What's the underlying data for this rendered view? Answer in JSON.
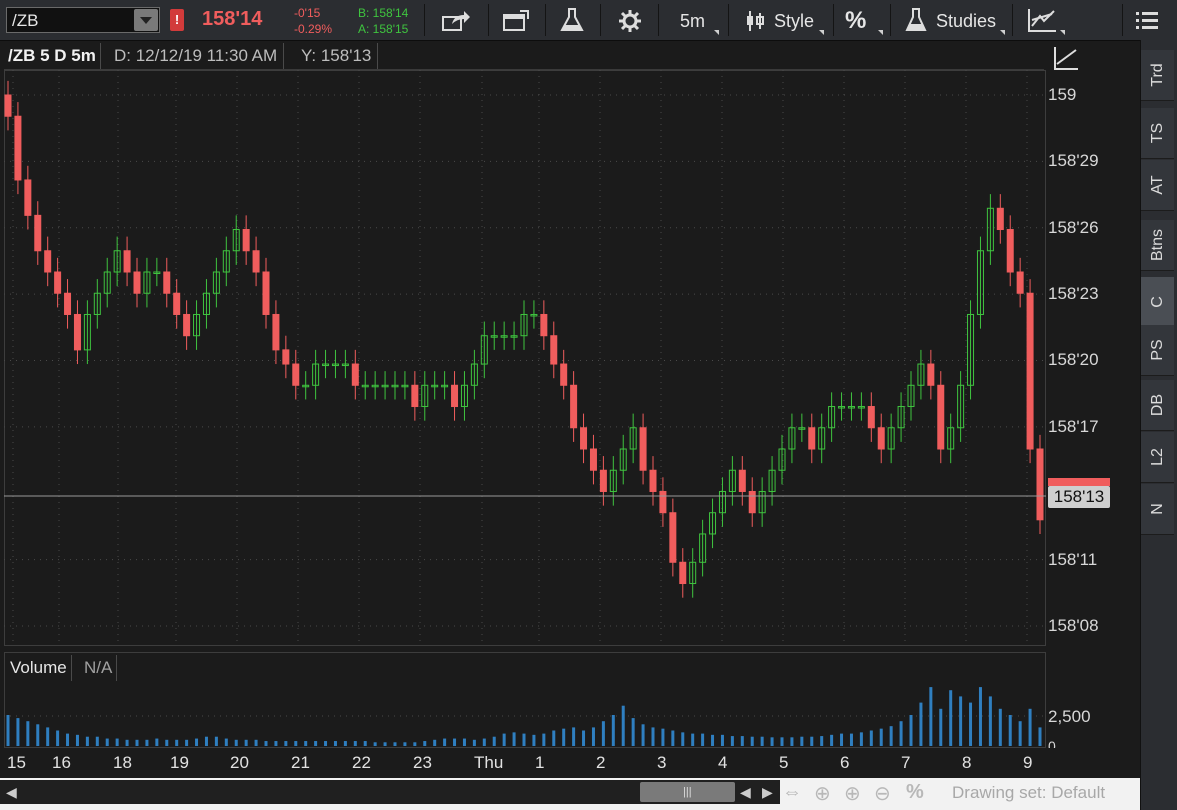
{
  "toolbar": {
    "symbol": "/ZB",
    "last_price": "158'14",
    "change_abs": "-0'15",
    "change_pct": "-0.29%",
    "bid": "B: 158'14",
    "ask": "A: 158'15",
    "timeframe_label": "5m",
    "style_label": "Style",
    "percent_label": "%",
    "studies_label": "Studies"
  },
  "chart_header": {
    "symbol_period": "/ZB 5 D 5m",
    "date_readout": "D: 12/12/19 11:30 AM",
    "y_readout": "Y: 158'13"
  },
  "price_axis": {
    "ticks": [
      "159",
      "158'29",
      "158'26",
      "158'23",
      "158'20",
      "158'17",
      "158'11",
      "158'08"
    ],
    "current_tag": "158'13"
  },
  "volume_panel": {
    "label": "Volume",
    "value": "N/A",
    "axis_tick": "2,500",
    "axis_zero": "0"
  },
  "time_axis": {
    "labels": [
      "15",
      "16",
      "18",
      "19",
      "20",
      "21",
      "22",
      "23",
      "Thu",
      "1",
      "2",
      "3",
      "4",
      "5",
      "6",
      "7",
      "8",
      "9"
    ]
  },
  "sidebar": {
    "tabs": [
      "Trd",
      "TS",
      "AT",
      "Btns",
      "C",
      "PS",
      "DB",
      "L2",
      "N"
    ],
    "active": "C"
  },
  "bottom_bar": {
    "drawing_set": "Drawing set: Default",
    "percent_label": "%"
  },
  "colors": {
    "up": "#3fc43f",
    "down": "#f05d5d",
    "volume": "#2f7fc0",
    "background": "#1b1b1b",
    "grid": "#4a4a4a"
  },
  "chart_data": {
    "type": "bar",
    "symbol": "/ZB",
    "aggregation": "5m",
    "span": "5 D",
    "title": "/ZB 5 D 5m",
    "ylim_ticks": [
      159.0,
      158.90625,
      158.8125,
      158.71875,
      158.625,
      158.53125,
      158.34375,
      158.25
    ],
    "y_format": "32nds",
    "closes": [
      158.97,
      158.88,
      158.83,
      158.78,
      158.75,
      158.72,
      158.69,
      158.64,
      158.69,
      158.72,
      158.75,
      158.78,
      158.75,
      158.72,
      158.75,
      158.75,
      158.72,
      158.69,
      158.66,
      158.69,
      158.72,
      158.75,
      158.78,
      158.81,
      158.78,
      158.75,
      158.69,
      158.64,
      158.62,
      158.59,
      158.59,
      158.62,
      158.62,
      158.62,
      158.62,
      158.59,
      158.59,
      158.59,
      158.59,
      158.59,
      158.59,
      158.56,
      158.59,
      158.59,
      158.59,
      158.56,
      158.59,
      158.62,
      158.66,
      158.66,
      158.66,
      158.66,
      158.69,
      158.69,
      158.66,
      158.62,
      158.59,
      158.53,
      158.5,
      158.47,
      158.44,
      158.47,
      158.5,
      158.53,
      158.47,
      158.44,
      158.41,
      158.34,
      158.31,
      158.34,
      158.38,
      158.41,
      158.44,
      158.47,
      158.44,
      158.41,
      158.44,
      158.47,
      158.5,
      158.53,
      158.53,
      158.5,
      158.53,
      158.56,
      158.56,
      158.56,
      158.56,
      158.53,
      158.5,
      158.53,
      158.56,
      158.59,
      158.62,
      158.59,
      158.5,
      158.53,
      158.59,
      158.69,
      158.78,
      158.84,
      158.81,
      158.75,
      158.72,
      158.5,
      158.4
    ],
    "volume_axis": {
      "tick": 2500
    },
    "volume_profile": [
      0.5,
      0.45,
      0.4,
      0.35,
      0.3,
      0.25,
      0.2,
      0.18,
      0.15,
      0.15,
      0.12,
      0.12,
      0.1,
      0.1,
      0.1,
      0.12,
      0.1,
      0.1,
      0.1,
      0.12,
      0.15,
      0.15,
      0.12,
      0.1,
      0.1,
      0.1,
      0.08,
      0.08,
      0.08,
      0.08,
      0.08,
      0.08,
      0.08,
      0.08,
      0.08,
      0.08,
      0.08,
      0.06,
      0.06,
      0.06,
      0.06,
      0.06,
      0.08,
      0.1,
      0.12,
      0.12,
      0.12,
      0.1,
      0.12,
      0.15,
      0.2,
      0.22,
      0.2,
      0.18,
      0.2,
      0.25,
      0.28,
      0.3,
      0.25,
      0.3,
      0.4,
      0.5,
      0.65,
      0.45,
      0.35,
      0.3,
      0.28,
      0.25,
      0.22,
      0.2,
      0.2,
      0.18,
      0.18,
      0.16,
      0.16,
      0.15,
      0.15,
      0.14,
      0.14,
      0.14,
      0.15,
      0.15,
      0.16,
      0.18,
      0.2,
      0.2,
      0.22,
      0.25,
      0.28,
      0.32,
      0.4,
      0.5,
      0.7,
      0.95,
      0.6,
      0.9,
      0.8,
      0.7,
      0.95,
      0.8,
      0.6,
      0.5,
      0.4,
      0.6,
      0.3
    ]
  }
}
